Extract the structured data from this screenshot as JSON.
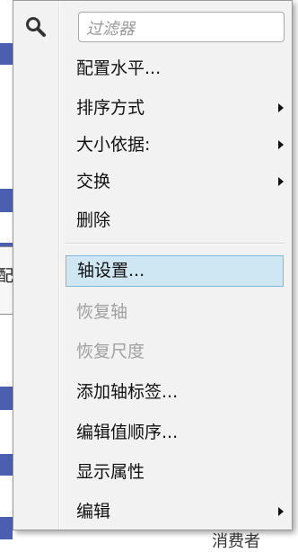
{
  "background": {
    "tooltip_text": "配",
    "bottom_text": "消费者"
  },
  "menu": {
    "filter_placeholder": "过滤器",
    "items": [
      {
        "label": "配置水平...",
        "enabled": true,
        "submenu": false
      },
      {
        "label": "排序方式",
        "enabled": true,
        "submenu": true
      },
      {
        "label": "大小依据:",
        "enabled": true,
        "submenu": true
      },
      {
        "label": "交换",
        "enabled": true,
        "submenu": true
      },
      {
        "label": "删除",
        "enabled": true,
        "submenu": false
      },
      {
        "label": "轴设置...",
        "enabled": true,
        "submenu": false,
        "highlighted": true
      },
      {
        "label": "恢复轴",
        "enabled": false,
        "submenu": false
      },
      {
        "label": "恢复尺度",
        "enabled": false,
        "submenu": false
      },
      {
        "label": "添加轴标签...",
        "enabled": true,
        "submenu": false
      },
      {
        "label": "编辑值顺序...",
        "enabled": true,
        "submenu": false
      },
      {
        "label": "显示属性",
        "enabled": true,
        "submenu": false
      },
      {
        "label": "编辑",
        "enabled": true,
        "submenu": true
      }
    ]
  },
  "colors": {
    "highlight_bg": "#cfe6f3",
    "highlight_border": "#7ab8de",
    "disabled_text": "#a0a0a0",
    "app_accent": "#4a5fb0"
  }
}
